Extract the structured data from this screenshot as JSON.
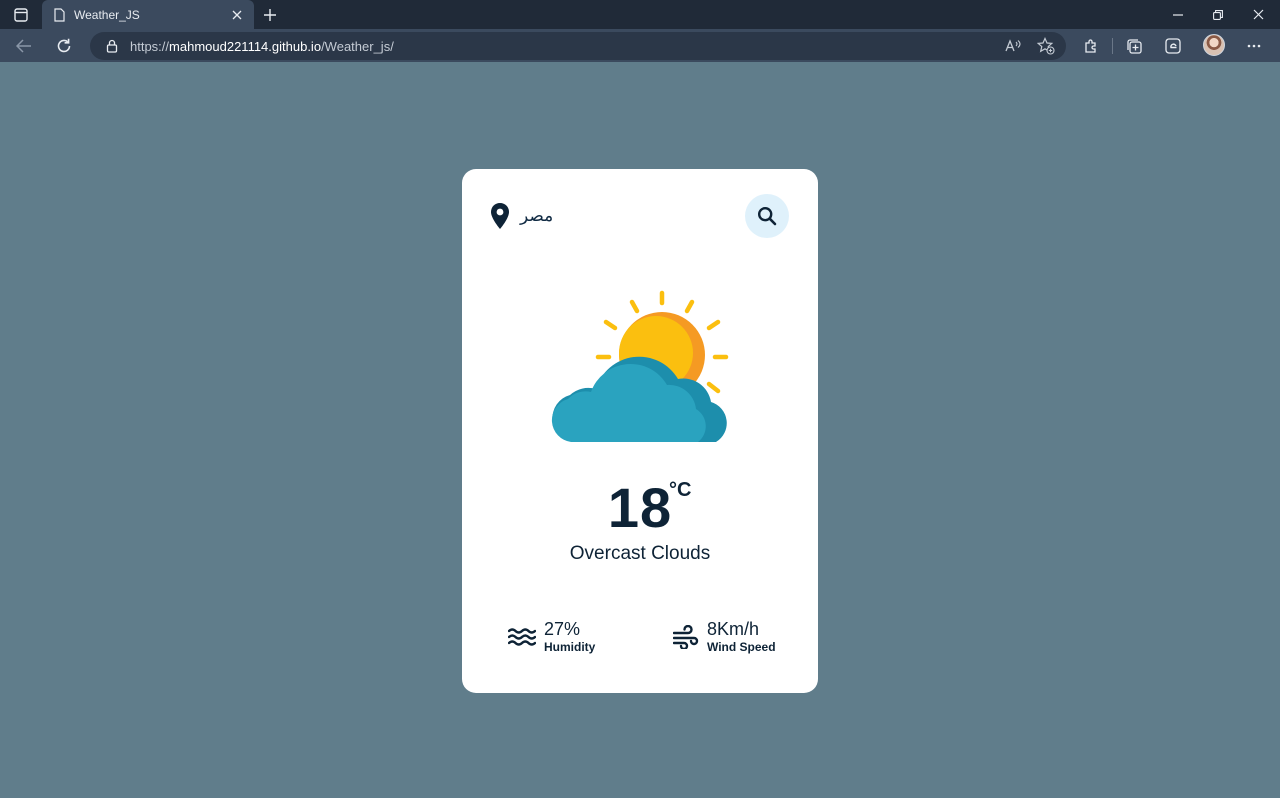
{
  "browser": {
    "tab_title": "Weather_JS",
    "url_scheme": "https://",
    "url_host": "mahmoud221114.github.io",
    "url_path": "/Weather_js/"
  },
  "weather": {
    "location": "مصر",
    "temperature": "18",
    "unit": "°C",
    "description": "Overcast Clouds",
    "humidity_value": "27%",
    "humidity_label": "Humidity",
    "wind_value": "8Km/h",
    "wind_label": "Wind Speed",
    "icon": "sun-behind-cloud-icon"
  },
  "colors": {
    "page_background": "#607d8b",
    "text_primary": "#0e2336",
    "search_button_bg": "#dff1fb",
    "sun": "#fbbf0f",
    "cloud": "#2aa3bf"
  }
}
